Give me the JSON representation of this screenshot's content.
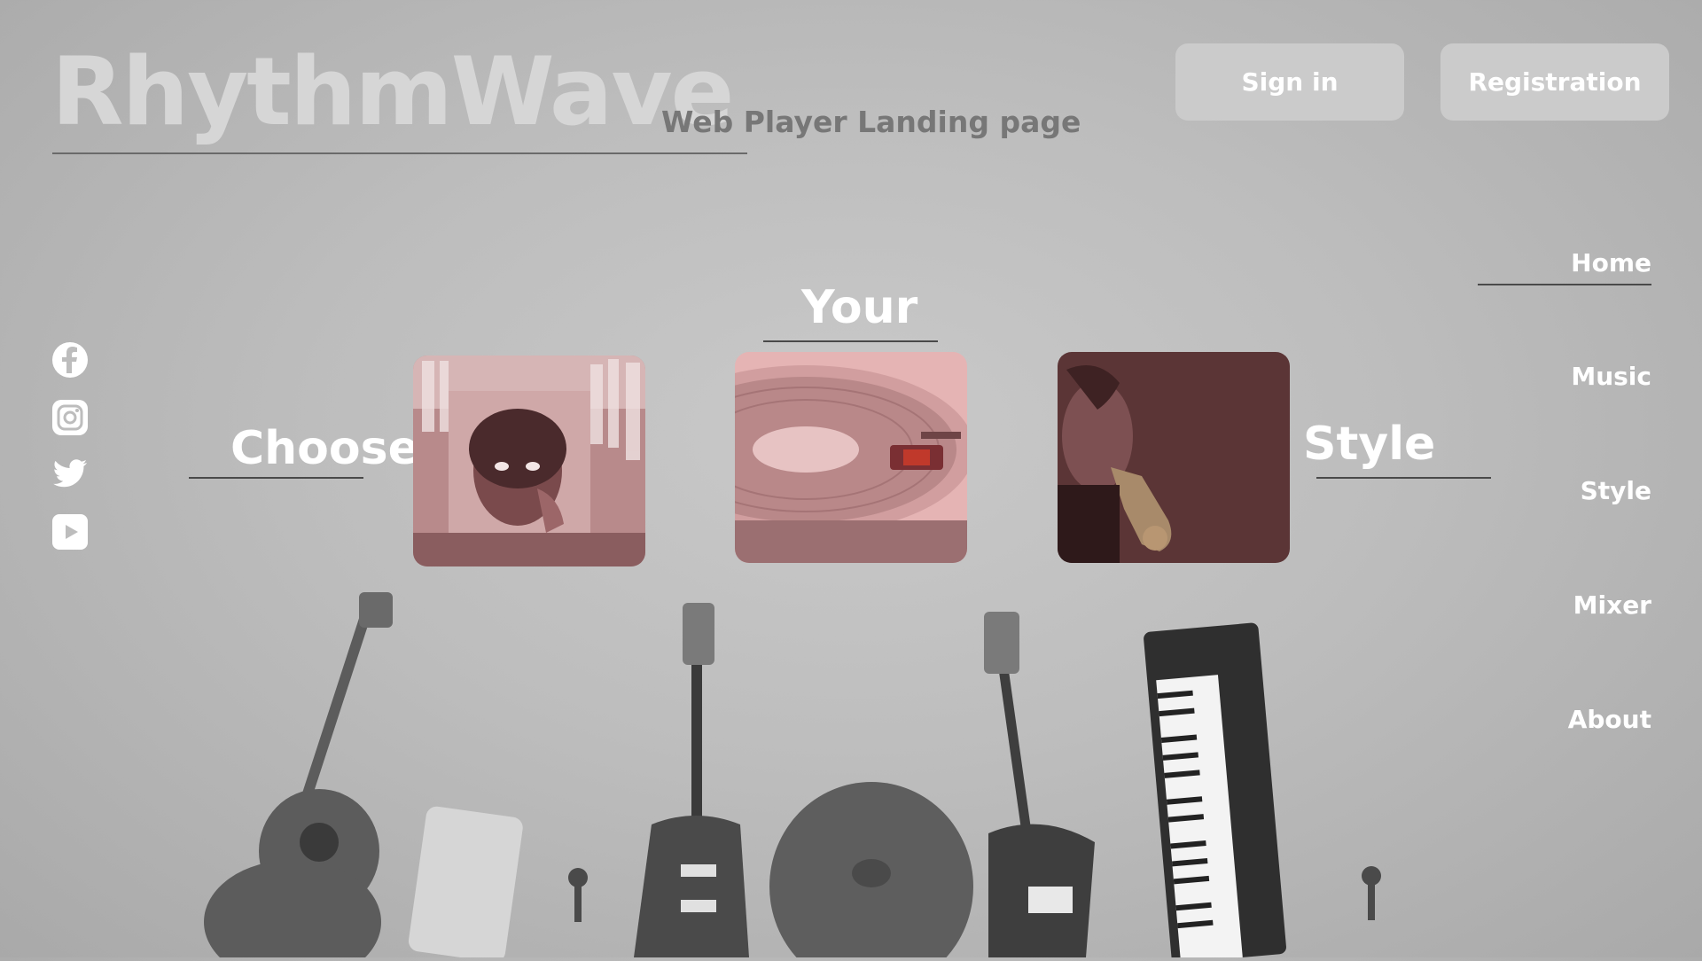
{
  "header": {
    "logo": "RhythmWave",
    "subtitle": "Web Player Landing page",
    "signin_label": "Sign in",
    "register_label": "Registration"
  },
  "nav": {
    "items": [
      "Home",
      "Music",
      "Style",
      "Mixer",
      "About"
    ]
  },
  "social": [
    "facebook-icon",
    "instagram-icon",
    "twitter-icon",
    "youtube-icon"
  ],
  "hero": {
    "word_choose": "Choose",
    "word_your": "Your",
    "word_style": "Style",
    "cards": [
      {
        "name": "record-crate-photo"
      },
      {
        "name": "turntable-photo"
      },
      {
        "name": "saxophonist-photo"
      }
    ]
  },
  "colors": {
    "accent_pink": "#e3a9a9",
    "accent_maroon": "#5b3536",
    "text_light": "#ffffff"
  }
}
